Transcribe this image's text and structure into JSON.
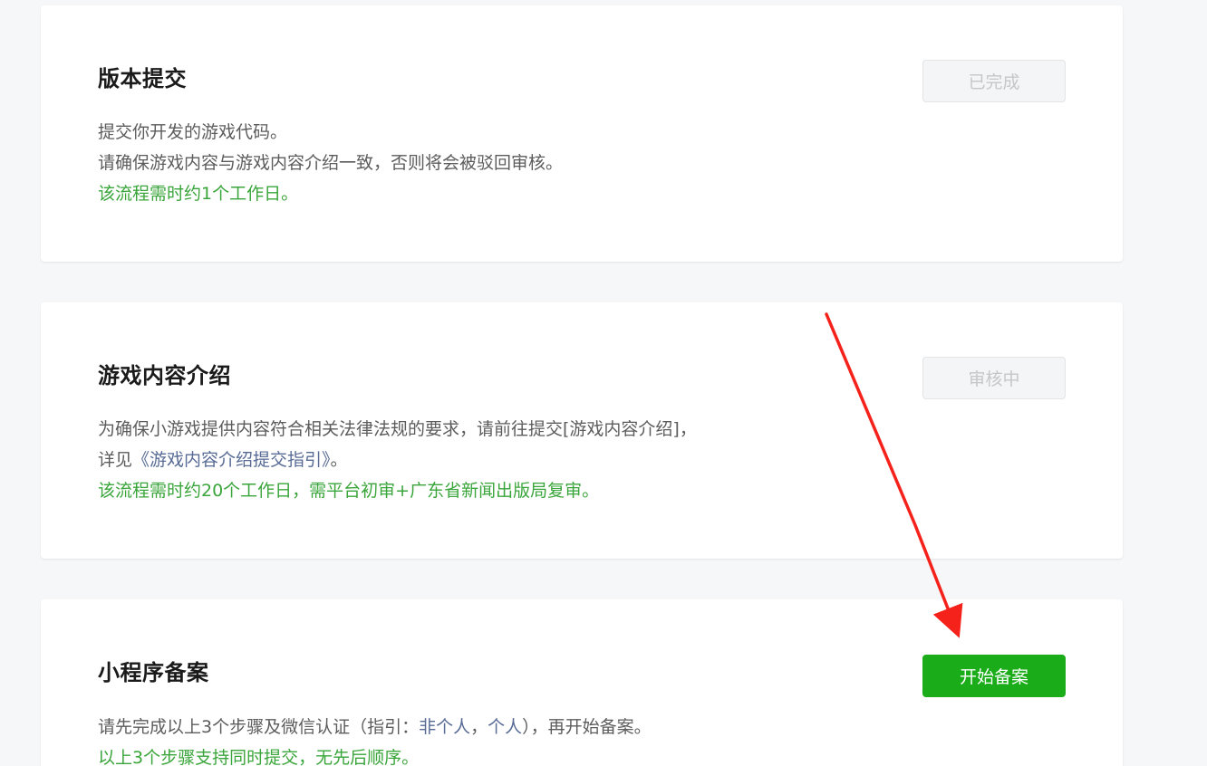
{
  "steps": [
    {
      "title": "版本提交",
      "button": "已完成",
      "lines": [
        "提交你开发的游戏代码。",
        "请确保游戏内容与游戏内容介绍一致，否则将会被驳回审核。"
      ],
      "note": "该流程需时约1个工作日。"
    },
    {
      "title": "游戏内容介绍",
      "button": "审核中",
      "lines": [
        "为确保小游戏提供内容符合相关法律法规的要求，请前往提交[游戏内容介绍]，"
      ],
      "detail_prefix": "详见",
      "detail_link": "《游戏内容介绍提交指引》",
      "detail_suffix": "。",
      "note": "该流程需时约20个工作日，需平台初审+广东省新闻出版局复审。"
    },
    {
      "title": "小程序备案",
      "button": "开始备案",
      "desc_prefix": "请先完成以上3个步骤及微信认证（指引：",
      "link_org": "非个人",
      "sep": "，",
      "link_person": "个人",
      "desc_suffix": "），再开始备案。",
      "note": "以上3个步骤支持同时提交，无先后顺序。"
    }
  ],
  "colors": {
    "background": "#f6f7f9",
    "card": "#ffffff",
    "primary_green": "#1aad19",
    "note_green": "#3aa53a",
    "link_blue": "#576b95",
    "disabled_text": "#c4c6c9",
    "annotation_arrow": "#f5221b"
  }
}
